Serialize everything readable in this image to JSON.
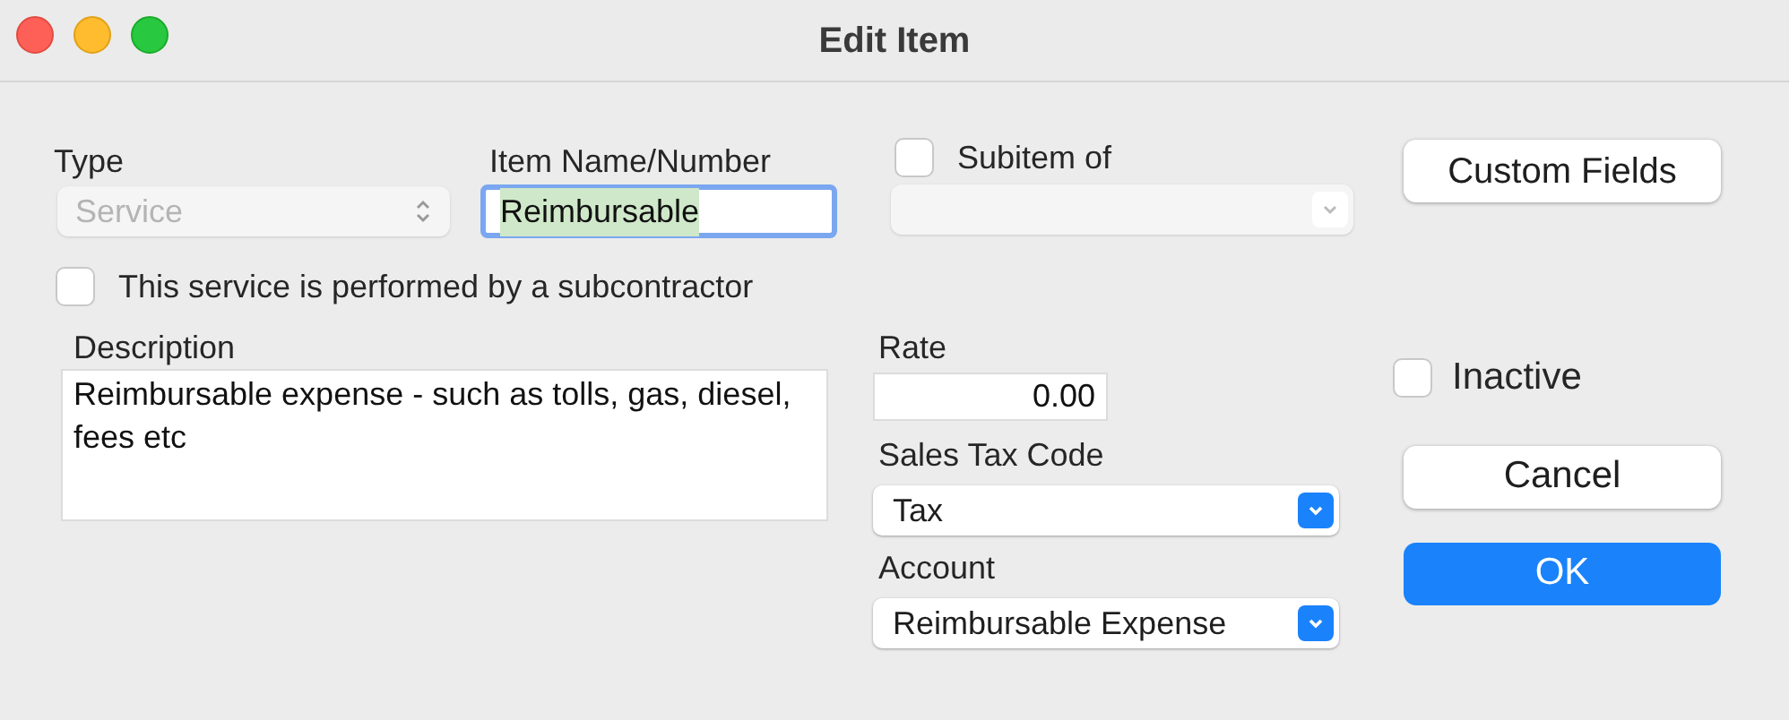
{
  "window": {
    "title": "Edit Item"
  },
  "type": {
    "label": "Type",
    "value": "Service",
    "disabled": true
  },
  "item_name": {
    "label": "Item Name/Number",
    "value": "Reimbursable",
    "focused": true
  },
  "subitem": {
    "label": "Subitem of",
    "checked": false,
    "disabled": true
  },
  "custom_fields_button": {
    "label": "Custom Fields"
  },
  "subcontractor": {
    "label": "This service is performed by a subcontractor",
    "checked": false
  },
  "description": {
    "label": "Description",
    "value": "Reimbursable expense - such as tolls, gas, diesel, fees etc"
  },
  "rate": {
    "label": "Rate",
    "value": "0.00"
  },
  "sales_tax_code": {
    "label": "Sales Tax Code",
    "value": "Tax"
  },
  "account": {
    "label": "Account",
    "value": "Reimbursable Expense"
  },
  "inactive": {
    "label": "Inactive",
    "checked": false
  },
  "buttons": [
    {
      "label": "Cancel",
      "default": false
    },
    {
      "label": "OK",
      "default": true
    }
  ]
}
